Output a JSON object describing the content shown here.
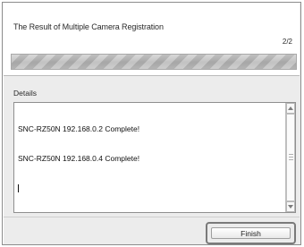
{
  "dialog": {
    "title": "The Result of Multiple Camera Registration",
    "page_counter": "2/2",
    "progress_fraction": 1.0
  },
  "details": {
    "label": "Details",
    "lines": [
      "SNC-RZ50N 192.168.0.2 Complete!",
      "SNC-RZ50N 192.168.0.4 Complete!"
    ]
  },
  "footer": {
    "finish_label": "Finish"
  },
  "icons": {
    "scroll_up": "scroll-up-icon",
    "scroll_down": "scroll-down-icon"
  }
}
